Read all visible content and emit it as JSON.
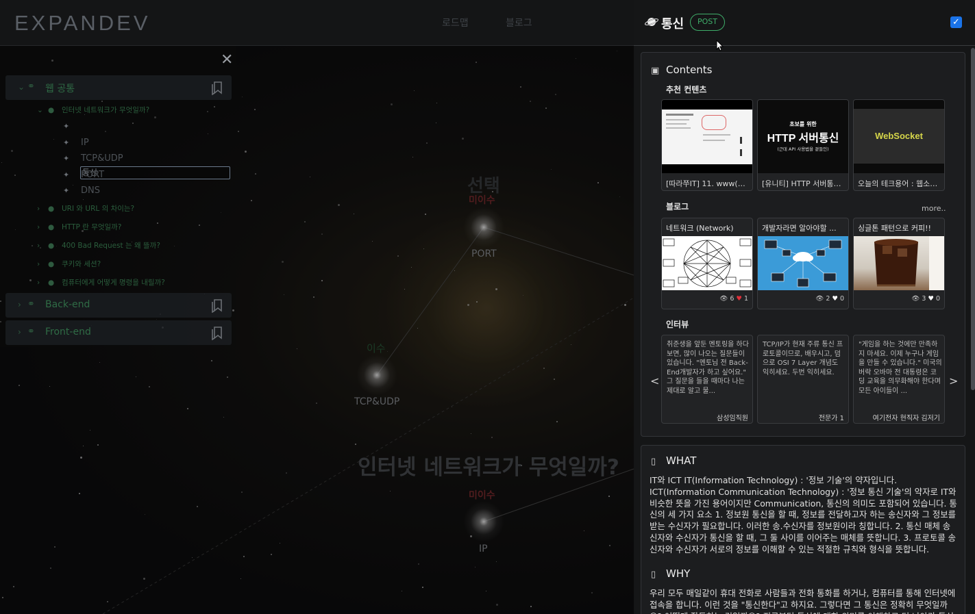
{
  "app": {
    "logo": "EXPANDEV",
    "nav": [
      "로드맵",
      "블로그"
    ]
  },
  "tree": {
    "close_icon": "close-icon",
    "categories": [
      {
        "label": "웹 공통",
        "expanded": true
      },
      {
        "label": "Back-end",
        "expanded": false
      },
      {
        "label": "Front-end",
        "expanded": false
      }
    ],
    "planets": [
      {
        "label": "인터넷 네트워크가 무엇일까?",
        "expanded": true
      },
      {
        "label": "URI 와 URL 의 차이는?"
      },
      {
        "label": "HTTP 란 무엇일까?"
      },
      {
        "label": "400 Bad Request 는 왜 뜰까?"
      },
      {
        "label": "쿠키와 세션?"
      },
      {
        "label": "컴퓨터에게 어떻게 명령을 내릴까?"
      }
    ],
    "leaves": [
      "통신",
      "IP",
      "TCP&UDP",
      "PORT",
      "DNS"
    ],
    "editing_value": "통신"
  },
  "map": {
    "planet_title": "인터넷 네트워크가 무엇일까?",
    "selected_word": "선택",
    "nodes": [
      {
        "label": "PORT",
        "tag": "미이수",
        "tag_color": "#7c2b2e"
      },
      {
        "label": "TCP&UDP",
        "tag": "이수",
        "tag_color": "#2a5a3a"
      },
      {
        "label": "IP",
        "tag": "미이수",
        "tag_color": "#7c2b2e"
      }
    ]
  },
  "panel": {
    "title": "통신",
    "badge": "POST",
    "checked": true,
    "contents": {
      "title": "Contents",
      "recommended_label": "추천 컨텐츠",
      "recommended": [
        {
          "caption": "[따라쭈IT] 11. www(웹)...",
          "thumb_type": "slides"
        },
        {
          "caption": "[유니티] HTTP 서버통신 ...",
          "thumb_type": "http",
          "thumb_small": "초보를 위한",
          "thumb_big": "HTTP 서버통신",
          "thumb_sub": "(근데 API 사용법을 곁들인)"
        },
        {
          "caption": "오늘의 테크용어 : 웹소켓...",
          "thumb_type": "websocket",
          "thumb_big": "WebSocket"
        }
      ],
      "blog_label": "블로그",
      "more": "more..",
      "blogs": [
        {
          "title": "네트워크 (Network)",
          "views": "6",
          "likes": "1",
          "liked": true
        },
        {
          "title": "개발자라면 알아야할 ...",
          "views": "2",
          "likes": "0",
          "liked": false
        },
        {
          "title": "싱글톤 패턴으로 커피!!",
          "views": "3",
          "likes": "0",
          "liked": false
        }
      ],
      "interview_label": "인터뷰",
      "interviews": [
        {
          "text": "취준생을 앞둔 멘토링을 하다보면, 많이 나오는 질문들이 있습니다. \"멘토님 전 Back-End개발자가 하고 싶어요.\" 그 질문을 들을 때마다 나는 제대로 알고 물...",
          "author": "삼성임직원"
        },
        {
          "text": "TCP/IP가 현재 주류 통신 프로토콜이므로, 배우시고, 덤으로 OSI 7 Layer 개념도 익히세요. 두번 익히세요.",
          "author": "전문가 1"
        },
        {
          "text": "\"게임을 하는 것에만 만족하지 마세요. 이제 누구나 게임을 만들 수 있습니다.\" 미국의 버락 오바마 전 대통령은 코딩 교육을 의무화해야 한다며 모든 아이들이 ...",
          "author": "여기전자 현직자 김저기"
        }
      ],
      "prev": "<",
      "next": ">"
    },
    "what": {
      "title": "WHAT",
      "body": "IT와 ICT IT(Information Technology) : '정보 기술'의 약자입니다. ICT(Information Communication Technology) : '정보 통신 기술'의 약자로 IT와 비슷한 뜻을 가진 용어이지만 Communication, 통신의 의미도 포함되어 있습니다. 통신의 세 가지 요소 1. 정보원 통신을 할 때, 정보를 전달하고자 하는 송신자와 그 정보를 받는 수신자가 필요합니다. 이러한 송.수신자를 정보원이라 칭합니다. 2. 통신 매체 송신자와 수신자가 통신을 할 때, 그 둘 사이를 이어주는 매체를 뜻합니다. 3. 프로토콜 송신자와 수신자가 서로의 정보를 이해할 수 있는 적절한 규칙와 형식을 뜻합니다."
    },
    "why": {
      "title": "WHY",
      "body": "우리 모두 매일같이 휴대 전화로 사람들과 전화 통화를 하거나, 컴퓨터를 통해 인터넷에 접속을 합니다. 이런 것을 \"통신한다\"고 하지요. 그렇다면 그 통신은 정확히 무엇일까요? 어떻게 작동하는 것일까요? 지금부터 통신에 대한 의미를 이해하고 더 나아가 통신의 목적, 구조 그"
    }
  },
  "colors": {
    "accent_green": "#3fae6a",
    "checkbox_blue": "#1a73e8",
    "heart_red": "#e0303a",
    "panel_bg": "#151617"
  }
}
